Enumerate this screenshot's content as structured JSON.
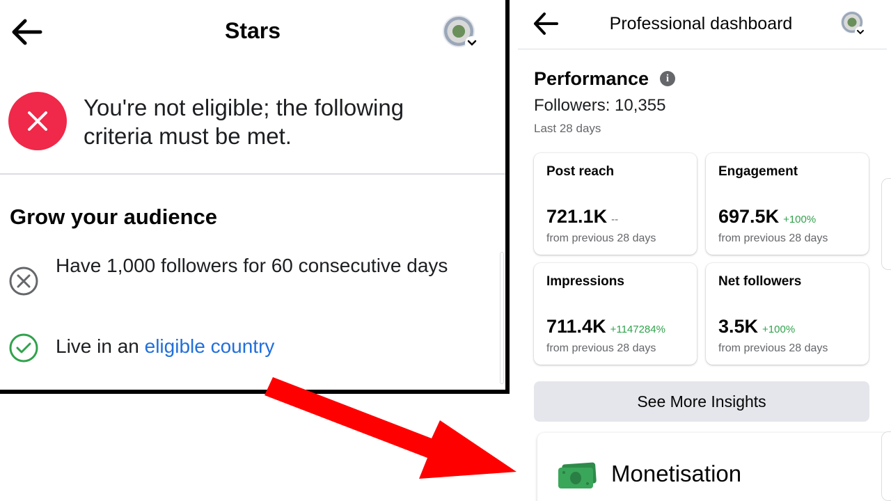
{
  "stars_screen": {
    "title": "Stars",
    "status_message": "You're not eligible; the following criteria must be met.",
    "section_title": "Grow your audience",
    "criteria": [
      {
        "text": "Have 1,000 followers for 60 consecutive days",
        "status": "not-met"
      },
      {
        "text_prefix": "Live in an ",
        "link_text": "eligible country",
        "status": "met"
      }
    ],
    "icons": {
      "back": "back-arrow-icon",
      "error": "close-icon",
      "not_met": "circle-x-icon",
      "met": "circle-check-icon"
    }
  },
  "dashboard_screen": {
    "title": "Professional dashboard",
    "performance": {
      "title": "Performance",
      "followers": "Followers: 10,355",
      "period": "Last 28 days"
    },
    "cards": [
      {
        "label": "Post reach",
        "value": "721.1K",
        "delta": "--",
        "sub": "from previous 28 days"
      },
      {
        "label": "Engagement",
        "value": "697.5K",
        "delta": "+100%",
        "sub": "from previous 28 days"
      },
      {
        "label": "Impressions",
        "value": "711.4K",
        "delta": "+1147284%",
        "sub": "from previous 28 days"
      },
      {
        "label": "Net followers",
        "value": "3.5K",
        "delta": "+100%",
        "sub": "from previous 28 days"
      }
    ],
    "insights_button": "See More Insights",
    "monetisation_label": "Monetisation"
  },
  "colors": {
    "error_red": "#f02849",
    "success_green": "#31a24c",
    "link_blue": "#216fdb",
    "arrow_red": "#ff0000",
    "money_green": "#3aa65a"
  }
}
